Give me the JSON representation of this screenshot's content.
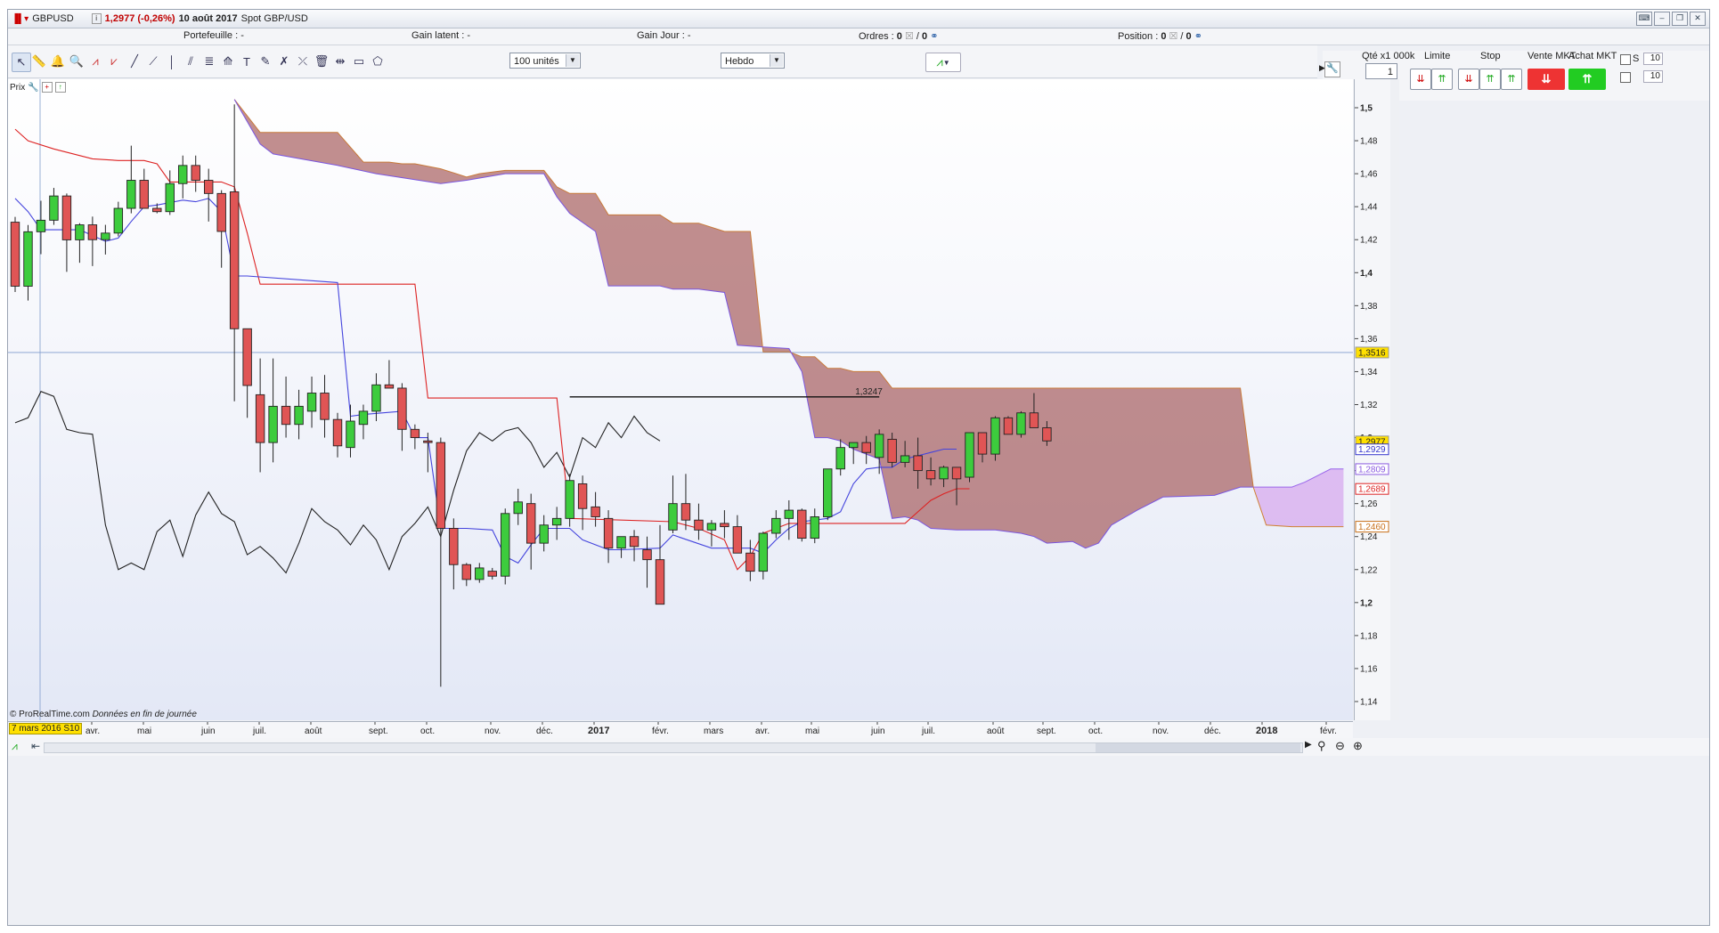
{
  "window": {
    "symbol": "GBPUSD",
    "price_change": "1,2977 (-0,26%)",
    "date": "10 août 2017",
    "instrument": "Spot GBP/USD"
  },
  "infobar": {
    "portefeuille": "Portefeuille : -",
    "gain_latent": "Gain latent : -",
    "gain_jour": "Gain Jour : -",
    "ordres_label": "Ordres :",
    "ordres_value": "0",
    "ordres_value2": "0",
    "position_label": "Position :",
    "position_value": "0",
    "position_value2": "0"
  },
  "toolbar": {
    "units_select": "100 unités",
    "period_select": "Hebdo"
  },
  "order_panel": {
    "qty_label": "Qté x1 000k",
    "qty_value": "1",
    "limite_label": "Limite",
    "stop_label": "Stop",
    "vente_label": "Vente MKT",
    "achat_label": "Achat MKT",
    "s_label": "S",
    "s_value": "10",
    "d_value": "10"
  },
  "chart_header": {
    "prix_label": "Prix"
  },
  "footer": {
    "copyright": "© ProRealTime.com",
    "note": "Données en fin de journée",
    "cursor_date": "7 mars 2016 S10"
  },
  "colors": {
    "bull": "#3dcc3d",
    "bear": "#e05555",
    "tenkan": "#4444dd",
    "kijun": "#dd2222",
    "chikou": "#222222",
    "cloud_bear": "#9c4a4a",
    "cloud_bull": "#d9b3f0"
  },
  "chart_data": {
    "type": "candlestick",
    "y_ticks": [
      "1,5",
      "1,48",
      "1,46",
      "1,44",
      "1,42",
      "1,4",
      "1,38",
      "1,36",
      "1,34",
      "1,32",
      "1,3",
      "1,28",
      "1,26",
      "1,24",
      "1,22",
      "1,2",
      "1,18",
      "1,16",
      "1,14"
    ],
    "x_ticks": [
      "avr.",
      "mai",
      "juin",
      "juil.",
      "août",
      "sept.",
      "oct.",
      "nov.",
      "déc.",
      "2017",
      "févr.",
      "mars",
      "avr.",
      "mai",
      "juin",
      "juil.",
      "août",
      "sept.",
      "oct.",
      "nov.",
      "déc.",
      "2018",
      "févr."
    ],
    "price_tags": [
      {
        "label": "1,3516",
        "kind": "crosshair"
      },
      {
        "label": "1,2977",
        "kind": "last"
      },
      {
        "label": "1,2929",
        "kind": "tenkan"
      },
      {
        "label": "1,2809",
        "kind": "cloud_b"
      },
      {
        "label": "1,2689",
        "kind": "kijun"
      },
      {
        "label": "1,2460",
        "kind": "cloud_a"
      }
    ],
    "annotation": {
      "label": "1,3247",
      "value": 1.3247
    },
    "candles": [
      [
        1.4306,
        1.4338,
        1.3883,
        1.3918
      ],
      [
        1.3918,
        1.4289,
        1.3831,
        1.4248
      ],
      [
        1.4248,
        1.4436,
        1.4112,
        1.4318
      ],
      [
        1.4318,
        1.4514,
        1.429,
        1.4465
      ],
      [
        1.4465,
        1.448,
        1.4005,
        1.4199
      ],
      [
        1.4199,
        1.43,
        1.406,
        1.429
      ],
      [
        1.429,
        1.434,
        1.404,
        1.42
      ],
      [
        1.42,
        1.429,
        1.411,
        1.424
      ],
      [
        1.424,
        1.443,
        1.422,
        1.439
      ],
      [
        1.439,
        1.477,
        1.436,
        1.456
      ],
      [
        1.456,
        1.463,
        1.439,
        1.439
      ],
      [
        1.439,
        1.442,
        1.436,
        1.437
      ],
      [
        1.437,
        1.462,
        1.435,
        1.454
      ],
      [
        1.454,
        1.471,
        1.445,
        1.465
      ],
      [
        1.465,
        1.471,
        1.449,
        1.456
      ],
      [
        1.456,
        1.463,
        1.431,
        1.448
      ],
      [
        1.448,
        1.45,
        1.403,
        1.425
      ],
      [
        1.449,
        1.502,
        1.322,
        1.366
      ],
      [
        1.366,
        1.353,
        1.312,
        1.3316
      ],
      [
        1.326,
        1.348,
        1.279,
        1.297
      ],
      [
        1.297,
        1.348,
        1.285,
        1.319
      ],
      [
        1.319,
        1.337,
        1.3,
        1.308
      ],
      [
        1.308,
        1.329,
        1.299,
        1.319
      ],
      [
        1.316,
        1.337,
        1.306,
        1.327
      ],
      [
        1.327,
        1.338,
        1.3,
        1.311
      ],
      [
        1.311,
        1.315,
        1.288,
        1.295
      ],
      [
        1.294,
        1.32,
        1.288,
        1.31
      ],
      [
        1.308,
        1.32,
        1.299,
        1.316
      ],
      [
        1.316,
        1.339,
        1.31,
        1.332
      ],
      [
        1.332,
        1.347,
        1.331,
        1.33
      ],
      [
        1.33,
        1.333,
        1.292,
        1.305
      ],
      [
        1.305,
        1.308,
        1.293,
        1.3
      ],
      [
        1.298,
        1.303,
        1.279,
        1.297
      ],
      [
        1.297,
        1.3,
        1.149,
        1.245
      ],
      [
        1.245,
        1.251,
        1.208,
        1.223
      ],
      [
        1.223,
        1.224,
        1.21,
        1.214
      ],
      [
        1.214,
        1.224,
        1.212,
        1.221
      ],
      [
        1.219,
        1.221,
        1.214,
        1.216
      ],
      [
        1.216,
        1.257,
        1.211,
        1.254
      ],
      [
        1.254,
        1.269,
        1.247,
        1.261
      ],
      [
        1.26,
        1.266,
        1.22,
        1.236
      ],
      [
        1.236,
        1.253,
        1.231,
        1.247
      ],
      [
        1.247,
        1.258,
        1.238,
        1.251
      ],
      [
        1.251,
        1.278,
        1.246,
        1.274
      ],
      [
        1.272,
        1.277,
        1.244,
        1.257
      ],
      [
        1.258,
        1.267,
        1.246,
        1.252
      ],
      [
        1.251,
        1.256,
        1.224,
        1.233
      ],
      [
        1.233,
        1.239,
        1.227,
        1.24
      ],
      [
        1.24,
        1.244,
        1.225,
        1.234
      ],
      [
        1.232,
        1.24,
        1.209,
        1.226
      ],
      [
        1.226,
        1.247,
        1.199,
        1.199
      ],
      [
        1.244,
        1.277,
        1.242,
        1.26
      ],
      [
        1.26,
        1.278,
        1.244,
        1.25
      ],
      [
        1.25,
        1.26,
        1.238,
        1.244
      ],
      [
        1.244,
        1.25,
        1.234,
        1.248
      ],
      [
        1.248,
        1.256,
        1.239,
        1.246
      ],
      [
        1.246,
        1.253,
        1.234,
        1.23
      ],
      [
        1.23,
        1.238,
        1.213,
        1.219
      ],
      [
        1.219,
        1.243,
        1.214,
        1.242
      ],
      [
        1.242,
        1.256,
        1.239,
        1.251
      ],
      [
        1.251,
        1.262,
        1.238,
        1.256
      ],
      [
        1.256,
        1.257,
        1.237,
        1.239
      ],
      [
        1.239,
        1.257,
        1.236,
        1.252
      ],
      [
        1.252,
        1.281,
        1.25,
        1.281
      ],
      [
        1.281,
        1.299,
        1.277,
        1.294
      ],
      [
        1.294,
        1.297,
        1.284,
        1.297
      ],
      [
        1.297,
        1.301,
        1.284,
        1.291
      ],
      [
        1.288,
        1.305,
        1.278,
        1.302
      ],
      [
        1.299,
        1.303,
        1.282,
        1.285
      ],
      [
        1.285,
        1.298,
        1.282,
        1.289
      ],
      [
        1.289,
        1.3,
        1.269,
        1.28
      ],
      [
        1.28,
        1.288,
        1.271,
        1.275
      ],
      [
        1.275,
        1.283,
        1.27,
        1.282
      ],
      [
        1.282,
        1.28,
        1.259,
        1.275
      ],
      [
        1.276,
        1.303,
        1.273,
        1.303
      ],
      [
        1.303,
        1.303,
        1.285,
        1.29
      ],
      [
        1.29,
        1.313,
        1.286,
        1.312
      ],
      [
        1.312,
        1.313,
        1.305,
        1.302
      ],
      [
        1.302,
        1.316,
        1.3,
        1.315
      ],
      [
        1.315,
        1.327,
        1.306,
        1.306
      ],
      [
        1.306,
        1.31,
        1.295,
        1.298
      ]
    ]
  }
}
